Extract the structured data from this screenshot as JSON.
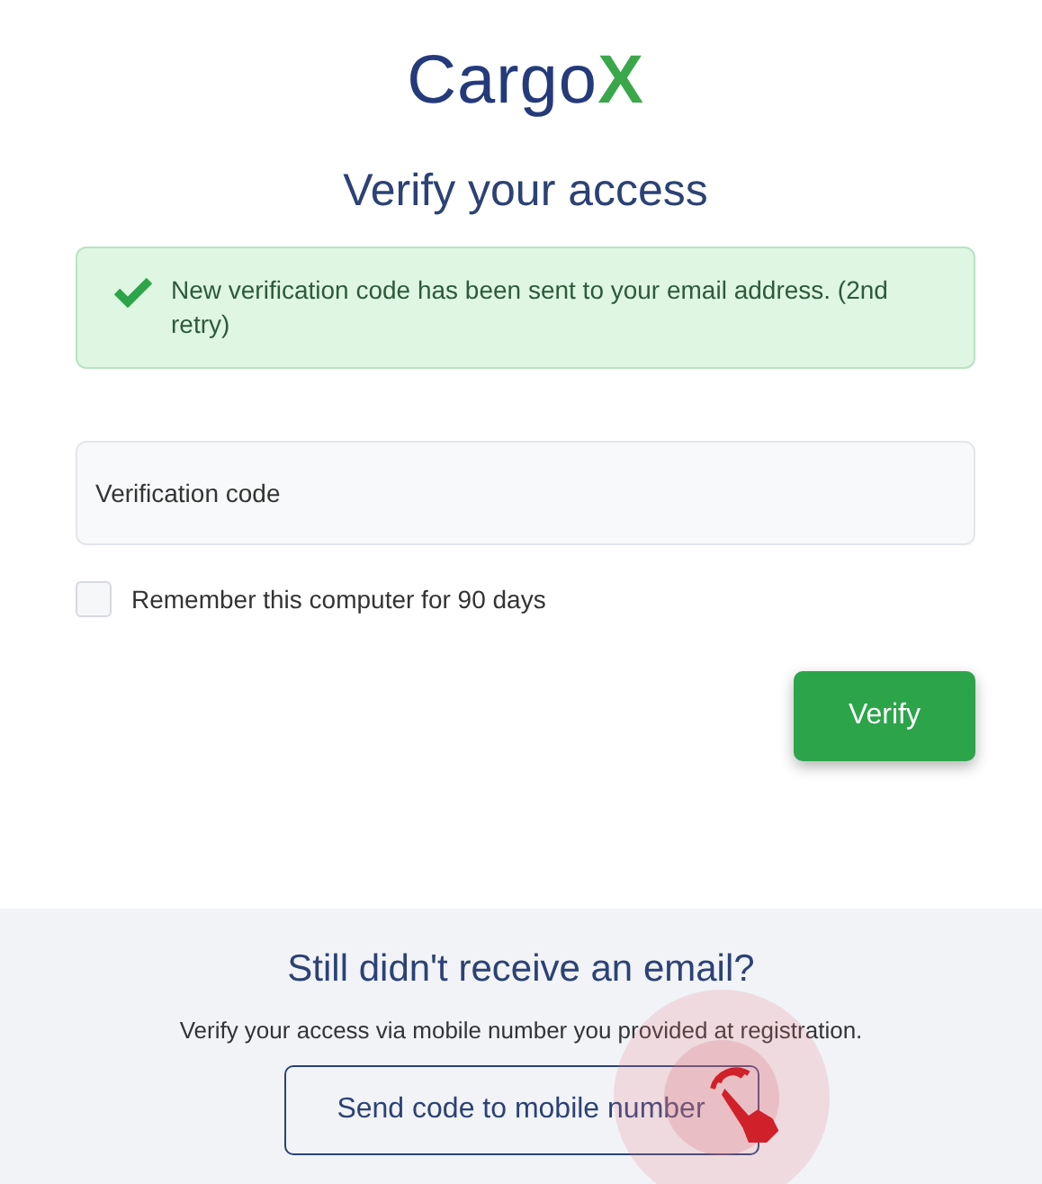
{
  "logo": {
    "text": "Cargo",
    "mark": "X"
  },
  "title": "Verify your access",
  "alert": {
    "kind": "success",
    "message": "New verification code has been sent to your email address. (2nd retry)"
  },
  "code_field": {
    "placeholder": "Verification code"
  },
  "remember": {
    "label": "Remember this computer for 90 days",
    "checked": false
  },
  "verify_button": "Verify",
  "footer": {
    "title": "Still didn't receive an email?",
    "text": "Verify your access via mobile number you provided at registration.",
    "button": "Send code to mobile number"
  }
}
